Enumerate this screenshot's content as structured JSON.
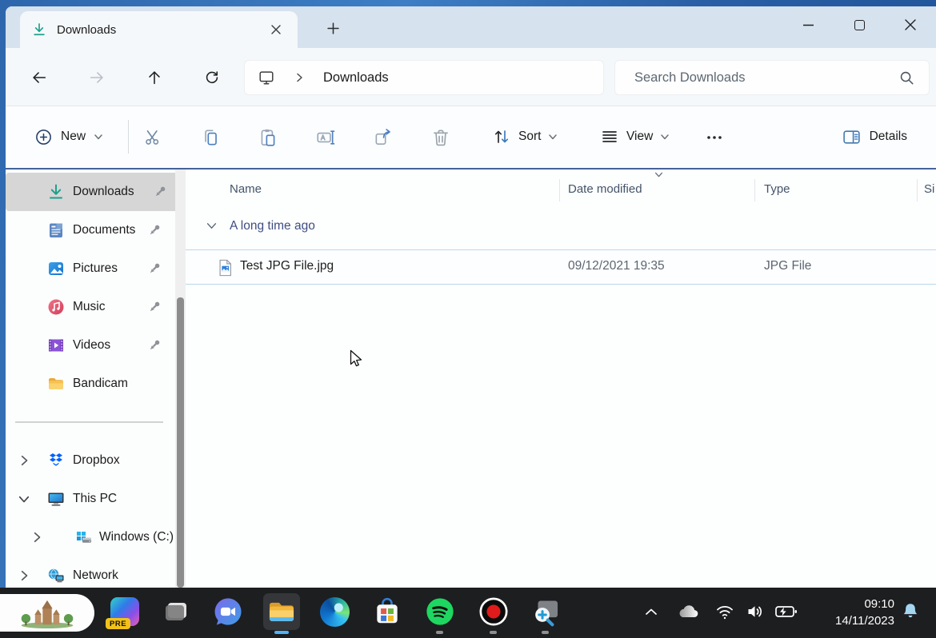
{
  "titlebar": {
    "tab_title": "Downloads"
  },
  "navbar": {
    "address_path": "Downloads",
    "search_placeholder": "Search Downloads"
  },
  "toolbar": {
    "new": "New",
    "sort": "Sort",
    "view": "View",
    "details": "Details"
  },
  "main": {
    "columns": [
      "Name",
      "Date modified",
      "Type",
      "Si"
    ],
    "group_label": "A long time ago",
    "files": [
      {
        "name": "Test JPG File.jpg",
        "date_modified": "09/12/2021 19:35",
        "type": "JPG File"
      }
    ]
  },
  "sidebar": {
    "items": [
      {
        "label": "Downloads"
      },
      {
        "label": "Documents"
      },
      {
        "label": "Pictures"
      },
      {
        "label": "Music"
      },
      {
        "label": "Videos"
      },
      {
        "label": "Bandicam"
      },
      {
        "label": "Dropbox"
      },
      {
        "label": "This PC"
      },
      {
        "label": "Windows (C:)"
      },
      {
        "label": "Network"
      }
    ]
  },
  "taskbar": {
    "copilot_badge": "PRE",
    "clock_time": "09:10",
    "clock_date": "14/11/2023"
  },
  "icons": {
    "tab_icon": "download-arrow",
    "nav": [
      "back-arrow",
      "forward-arrow",
      "up-arrow",
      "refresh"
    ],
    "address": [
      "this-pc-monitor",
      "chevron-right"
    ],
    "search": "magnifier",
    "toolbar": [
      "plus-circle",
      "cut-scissors",
      "copy-pages",
      "paste-clipboard",
      "rename",
      "share",
      "delete-trash",
      "sort-arrows",
      "view-lines",
      "more-dots",
      "details-panel"
    ],
    "tray": [
      "chevron-up",
      "onedrive-cloud",
      "wifi",
      "volume",
      "battery-charging",
      "notification-bell"
    ]
  },
  "colors": {
    "accent_blue": "#4d7fc1",
    "titlebar": "#d6e2ee",
    "chrome": "#f4f8fb",
    "selection_border": "#b9d8ec",
    "sidebar_selected": "#d6d6d6",
    "group_header_text": "#3f4e82",
    "downloads_teal": "#1ea08c",
    "taskbar": "#1d1e20"
  }
}
